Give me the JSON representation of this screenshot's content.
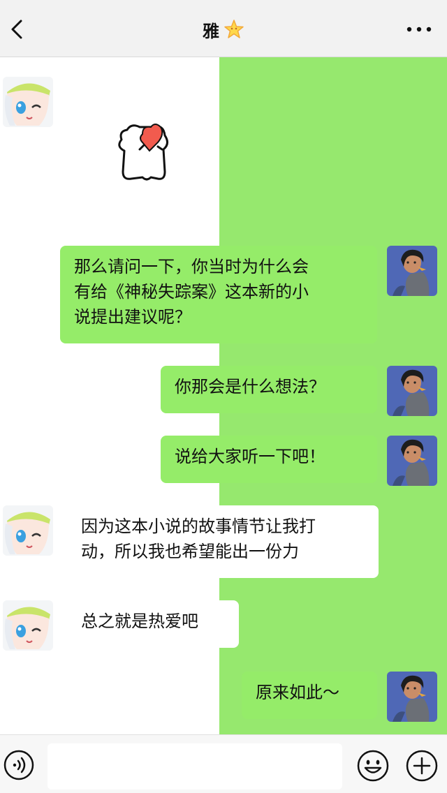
{
  "header": {
    "title": "雅",
    "back_icon": "chevron-left-icon",
    "title_badge_icon": "star-icon",
    "more_icon": "more-dots-icon"
  },
  "messages": [
    {
      "side": "in",
      "type": "sticker",
      "sticker": "bear-holding-heart-sticker"
    },
    {
      "side": "out",
      "type": "text",
      "lines": [
        "那么请问一下，你当时为什么会",
        "有给《神秘失踪案》这本新的小",
        "说提出建议呢？"
      ]
    },
    {
      "side": "out",
      "type": "text",
      "lines": [
        "你那会是什么想法？"
      ]
    },
    {
      "side": "out",
      "type": "text",
      "lines": [
        "说给大家听一下吧！"
      ]
    },
    {
      "side": "in",
      "type": "text",
      "lines": [
        "因为这本小说的故事情节让我打",
        "动，所以我也希望能出一份力"
      ]
    },
    {
      "side": "in",
      "type": "text",
      "lines": [
        "总之就是热爱吧"
      ]
    },
    {
      "side": "out",
      "type": "text",
      "lines": [
        "原来如此～"
      ]
    }
  ],
  "input_bar": {
    "placeholder": "",
    "voice_icon": "voice-icon",
    "emoji_icon": "emoji-icon",
    "plus_icon": "plus-icon"
  },
  "colors": {
    "green_background": "#96e86e",
    "outgoing_bubble": "#95ec69",
    "incoming_bubble": "#ffffff",
    "header_background": "#f2f2f2"
  }
}
